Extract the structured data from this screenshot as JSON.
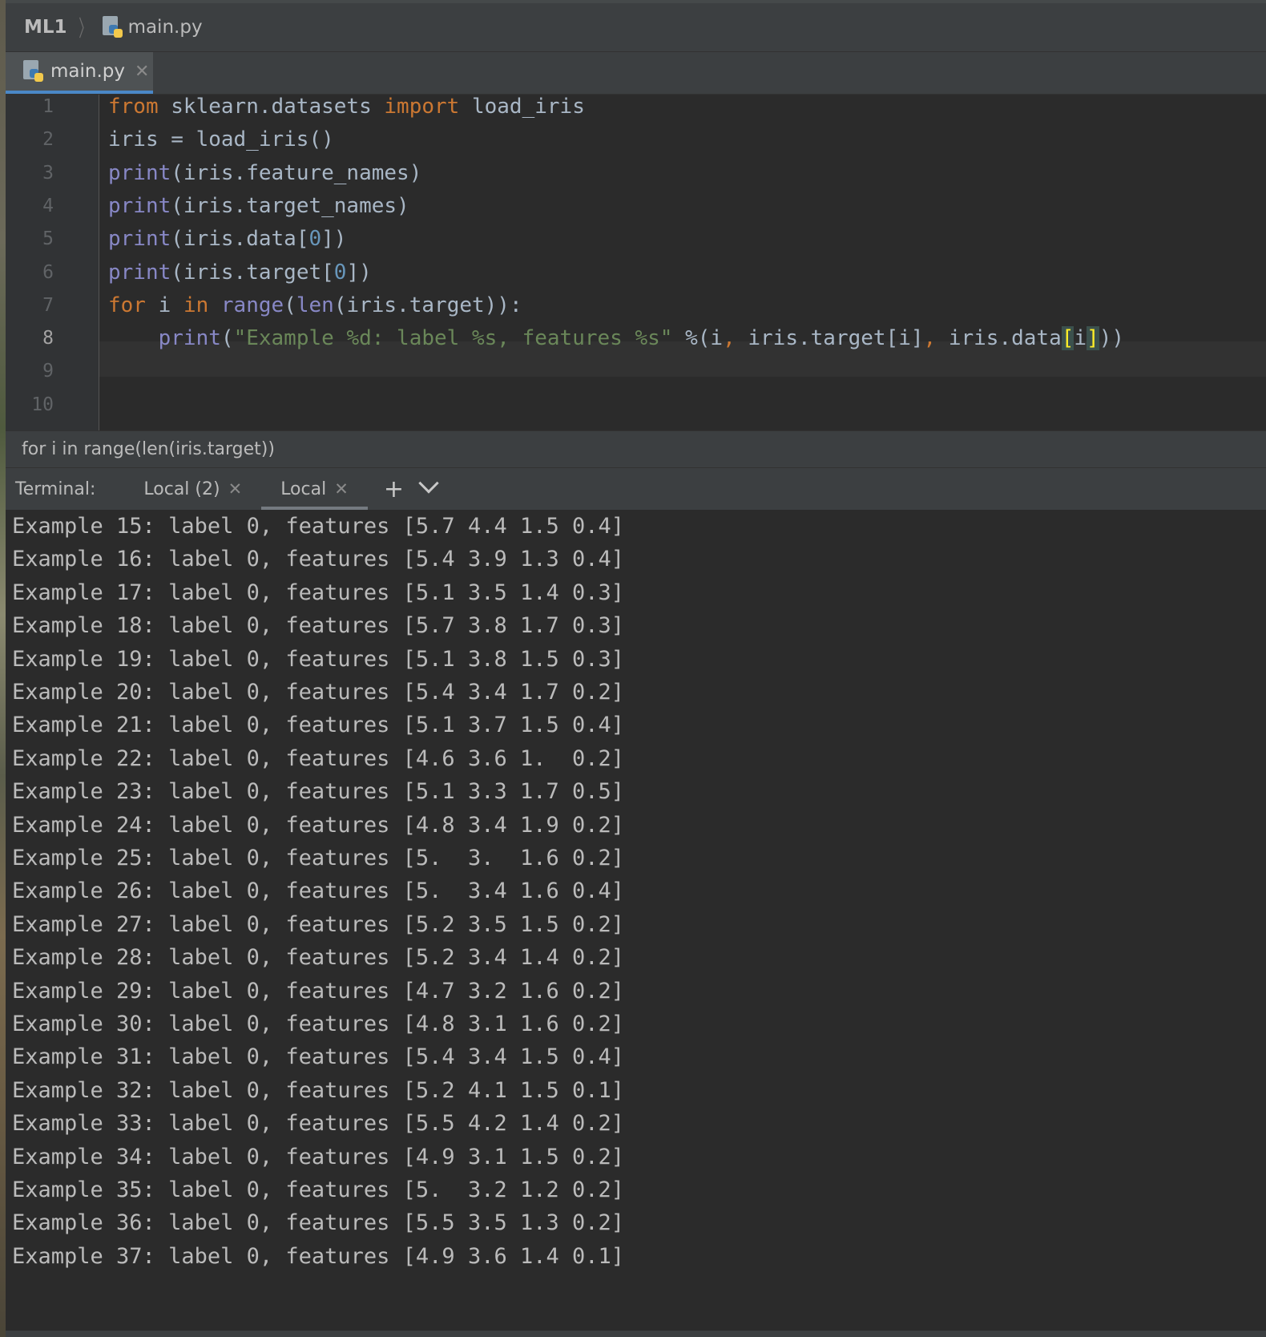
{
  "navbar": {
    "project": "ML1",
    "file": "main.py"
  },
  "editor_tab": {
    "label": "main.py",
    "close": "✕"
  },
  "editor": {
    "line_numbers": [
      "1",
      "2",
      "3",
      "4",
      "5",
      "6",
      "7",
      "8",
      "9",
      "10"
    ],
    "lines": [
      [
        [
          "kw",
          "from"
        ],
        [
          "p",
          " sklearn.datasets "
        ],
        [
          "kw",
          "import"
        ],
        [
          "p",
          " load_iris"
        ]
      ],
      [
        [
          "p",
          "iris = load_iris()"
        ]
      ],
      [
        [
          "bi",
          "print"
        ],
        [
          "p",
          "(iris.feature_names)"
        ]
      ],
      [
        [
          "bi",
          "print"
        ],
        [
          "p",
          "(iris.target_names)"
        ]
      ],
      [
        [
          "bi",
          "print"
        ],
        [
          "p",
          "(iris.data["
        ],
        [
          "num",
          "0"
        ],
        [
          "p",
          "])"
        ]
      ],
      [
        [
          "bi",
          "print"
        ],
        [
          "p",
          "(iris.target["
        ],
        [
          "num",
          "0"
        ],
        [
          "p",
          "])"
        ]
      ],
      [
        [
          "kw",
          "for"
        ],
        [
          "p",
          " i "
        ],
        [
          "kw",
          "in"
        ],
        [
          "p",
          " "
        ],
        [
          "bi",
          "range"
        ],
        [
          "p",
          "("
        ],
        [
          "bi",
          "len"
        ],
        [
          "p",
          "(iris.target)):"
        ]
      ],
      [
        [
          "p",
          "    "
        ],
        [
          "bi",
          "print"
        ],
        [
          "p",
          "("
        ],
        [
          "str",
          "\"Example %d: label %s, features %s\""
        ],
        [
          "p",
          " %(i"
        ],
        [
          "kw",
          ","
        ],
        [
          "p",
          " iris.target[i]"
        ],
        [
          "kw",
          ","
        ],
        [
          "p",
          " iris.data"
        ],
        [
          "brh",
          "["
        ],
        [
          "p",
          "i"
        ],
        [
          "brh",
          "]"
        ],
        [
          "p",
          "))"
        ]
      ],
      [
        [
          "p",
          ""
        ]
      ]
    ]
  },
  "breadcrumb": "for i in range(len(iris.target))",
  "terminal": {
    "title": "Terminal:",
    "tabs": [
      {
        "label": "Local (2)",
        "close": "✕"
      },
      {
        "label": "Local",
        "close": "✕"
      }
    ],
    "add": "+",
    "output": [
      "Example 15: label 0, features [5.7 4.4 1.5 0.4]",
      "Example 16: label 0, features [5.4 3.9 1.3 0.4]",
      "Example 17: label 0, features [5.1 3.5 1.4 0.3]",
      "Example 18: label 0, features [5.7 3.8 1.7 0.3]",
      "Example 19: label 0, features [5.1 3.8 1.5 0.3]",
      "Example 20: label 0, features [5.4 3.4 1.7 0.2]",
      "Example 21: label 0, features [5.1 3.7 1.5 0.4]",
      "Example 22: label 0, features [4.6 3.6 1.  0.2]",
      "Example 23: label 0, features [5.1 3.3 1.7 0.5]",
      "Example 24: label 0, features [4.8 3.4 1.9 0.2]",
      "Example 25: label 0, features [5.  3.  1.6 0.2]",
      "Example 26: label 0, features [5.  3.4 1.6 0.4]",
      "Example 27: label 0, features [5.2 3.5 1.5 0.2]",
      "Example 28: label 0, features [5.2 3.4 1.4 0.2]",
      "Example 29: label 0, features [4.7 3.2 1.6 0.2]",
      "Example 30: label 0, features [4.8 3.1 1.6 0.2]",
      "Example 31: label 0, features [5.4 3.4 1.5 0.4]",
      "Example 32: label 0, features [5.2 4.1 1.5 0.1]",
      "Example 33: label 0, features [5.5 4.2 1.4 0.2]",
      "Example 34: label 0, features [4.9 3.1 1.5 0.2]",
      "Example 35: label 0, features [5.  3.2 1.2 0.2]",
      "Example 36: label 0, features [5.5 3.5 1.3 0.2]",
      "Example 37: label 0, features [4.9 3.6 1.4 0.1]"
    ]
  }
}
